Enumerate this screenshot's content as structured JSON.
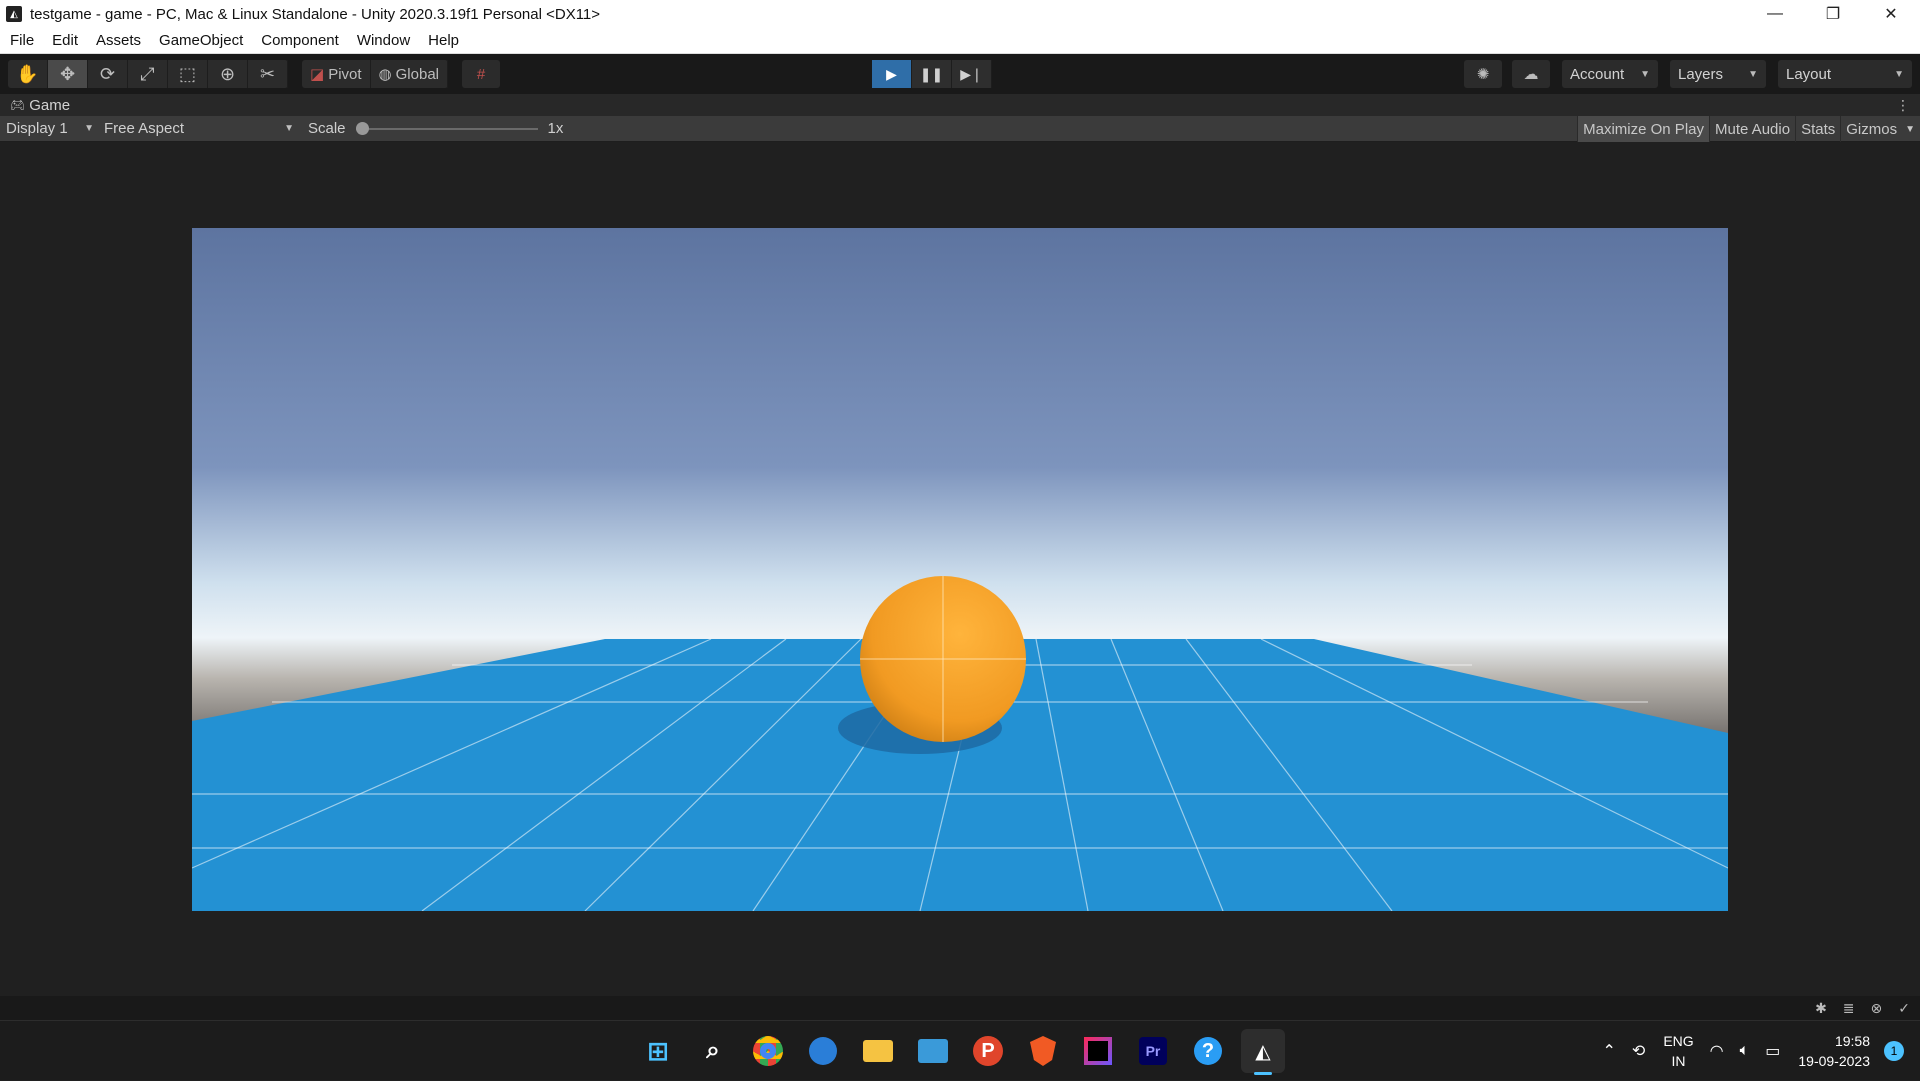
{
  "window": {
    "title": "testgame - game - PC, Mac & Linux Standalone - Unity 2020.3.19f1 Personal <DX11>",
    "minimize_icon": "minimize-icon",
    "restore_icon": "restore-icon",
    "close_icon": "close-icon"
  },
  "menu": {
    "items": [
      "File",
      "Edit",
      "Assets",
      "GameObject",
      "Component",
      "Window",
      "Help"
    ]
  },
  "toolbar": {
    "pivot_label": "Pivot",
    "global_label": "Global",
    "account_label": "Account",
    "layers_label": "Layers",
    "layout_label": "Layout",
    "play_state": "playing"
  },
  "game_tab": {
    "label": "Game"
  },
  "game_toolbar": {
    "display": "Display 1",
    "aspect": "Free Aspect",
    "scale_label": "Scale",
    "scale_value": "1x",
    "scale_fraction": 0.0,
    "maximize_on_play": "Maximize On Play",
    "mute_audio": "Mute Audio",
    "stats": "Stats",
    "gizmos": "Gizmos"
  },
  "colors": {
    "play_active": "#2f6ea8",
    "sky_top": "#5d74a0",
    "sky_horizon": "#eef4f8",
    "ground": "#6e6a67",
    "plane": "#2391d3",
    "sphere": "#f2a02a"
  },
  "taskbar": {
    "apps": [
      "windows-start-icon",
      "search-icon",
      "chrome-icon",
      "edge-dev-icon",
      "file-explorer-icon",
      "keyboard-app-icon",
      "pocket-app-icon",
      "brave-icon",
      "jetbrains-icon",
      "premiere-pro-icon",
      "help-app-icon",
      "unity-icon"
    ],
    "lang_line1": "ENG",
    "lang_line2": "IN",
    "time": "19:58",
    "date": "19-09-2023",
    "notifications": "1"
  }
}
